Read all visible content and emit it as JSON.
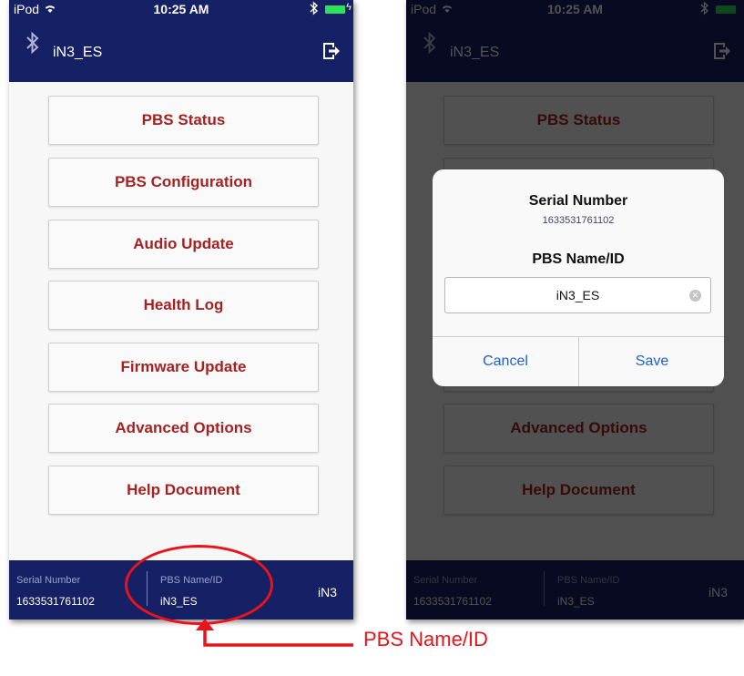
{
  "status_bar": {
    "carrier": "iPod",
    "time": "10:25 AM"
  },
  "nav": {
    "title": "iN3_ES"
  },
  "menu": [
    "PBS Status",
    "PBS Configuration",
    "Audio Update",
    "Health Log",
    "Firmware Update",
    "Advanced Options",
    "Help Document"
  ],
  "footer": {
    "serial_label": "Serial Number",
    "serial_value": "1633531761102",
    "name_label": "PBS Name/ID",
    "name_value": "iN3_ES",
    "model": "iN3"
  },
  "dialog": {
    "title": "Serial Number",
    "serial": "1633531761102",
    "subtitle": "PBS Name/ID",
    "input_value": "iN3_ES",
    "cancel_label": "Cancel",
    "save_label": "Save"
  },
  "annotation": {
    "label": "PBS Name/ID"
  },
  "colors": {
    "header_bg": "#162064",
    "menu_text": "#a62222",
    "dialog_button": "#1d62cf",
    "annotation": "#e8141b",
    "battery": "#2ee05a"
  }
}
